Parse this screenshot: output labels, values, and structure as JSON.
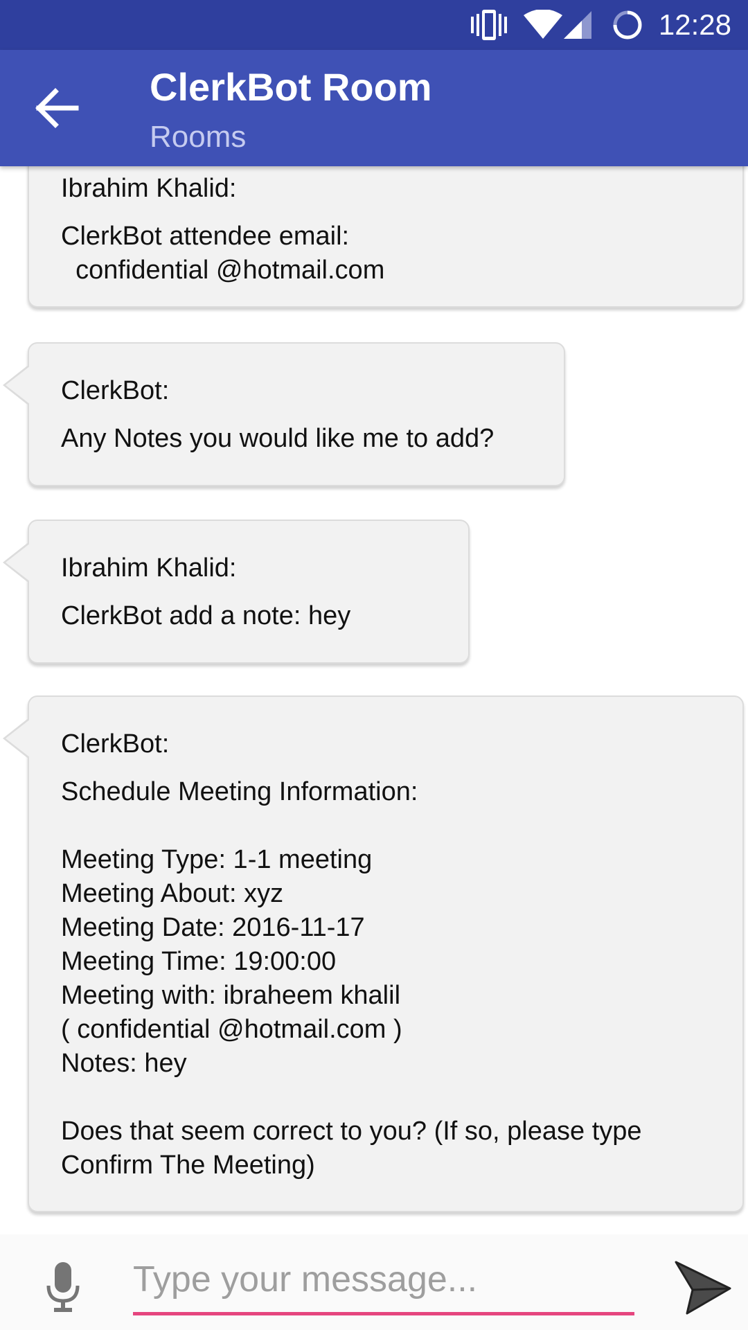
{
  "status_bar": {
    "time": "12:28",
    "icons": [
      "vibrate-icon",
      "wifi-icon",
      "cell-signal-icon",
      "loading-icon"
    ]
  },
  "app_bar": {
    "title": "ClerkBot Room",
    "subtitle": "Rooms",
    "back_icon": "arrow-back-icon"
  },
  "messages": [
    {
      "sender": "Ibrahim Khalid:",
      "text": "ClerkBot attendee email:\n  confidential @hotmail.com"
    },
    {
      "sender": "ClerkBot:",
      "text": "Any Notes you would like me to add?"
    },
    {
      "sender": "Ibrahim Khalid:",
      "text": "ClerkBot add a note: hey"
    },
    {
      "sender": "ClerkBot:",
      "text": "Schedule Meeting Information:\n\nMeeting Type: 1-1 meeting\nMeeting About: xyz\nMeeting Date: 2016-11-17\nMeeting Time: 19:00:00\nMeeting with: ibraheem khalil\n( confidential @hotmail.com )\nNotes: hey\n\nDoes that seem correct to you? (If so, please type\nConfirm The Meeting)"
    }
  ],
  "input_bar": {
    "placeholder": "Type your message...",
    "value": "",
    "mic_icon": "microphone-icon",
    "send_icon": "send-icon",
    "underline_color": "#e5457e"
  },
  "colors": {
    "status_bar": "#2f3f9e",
    "app_bar": "#3f51b5",
    "bubble_background": "#f2f2f2"
  }
}
